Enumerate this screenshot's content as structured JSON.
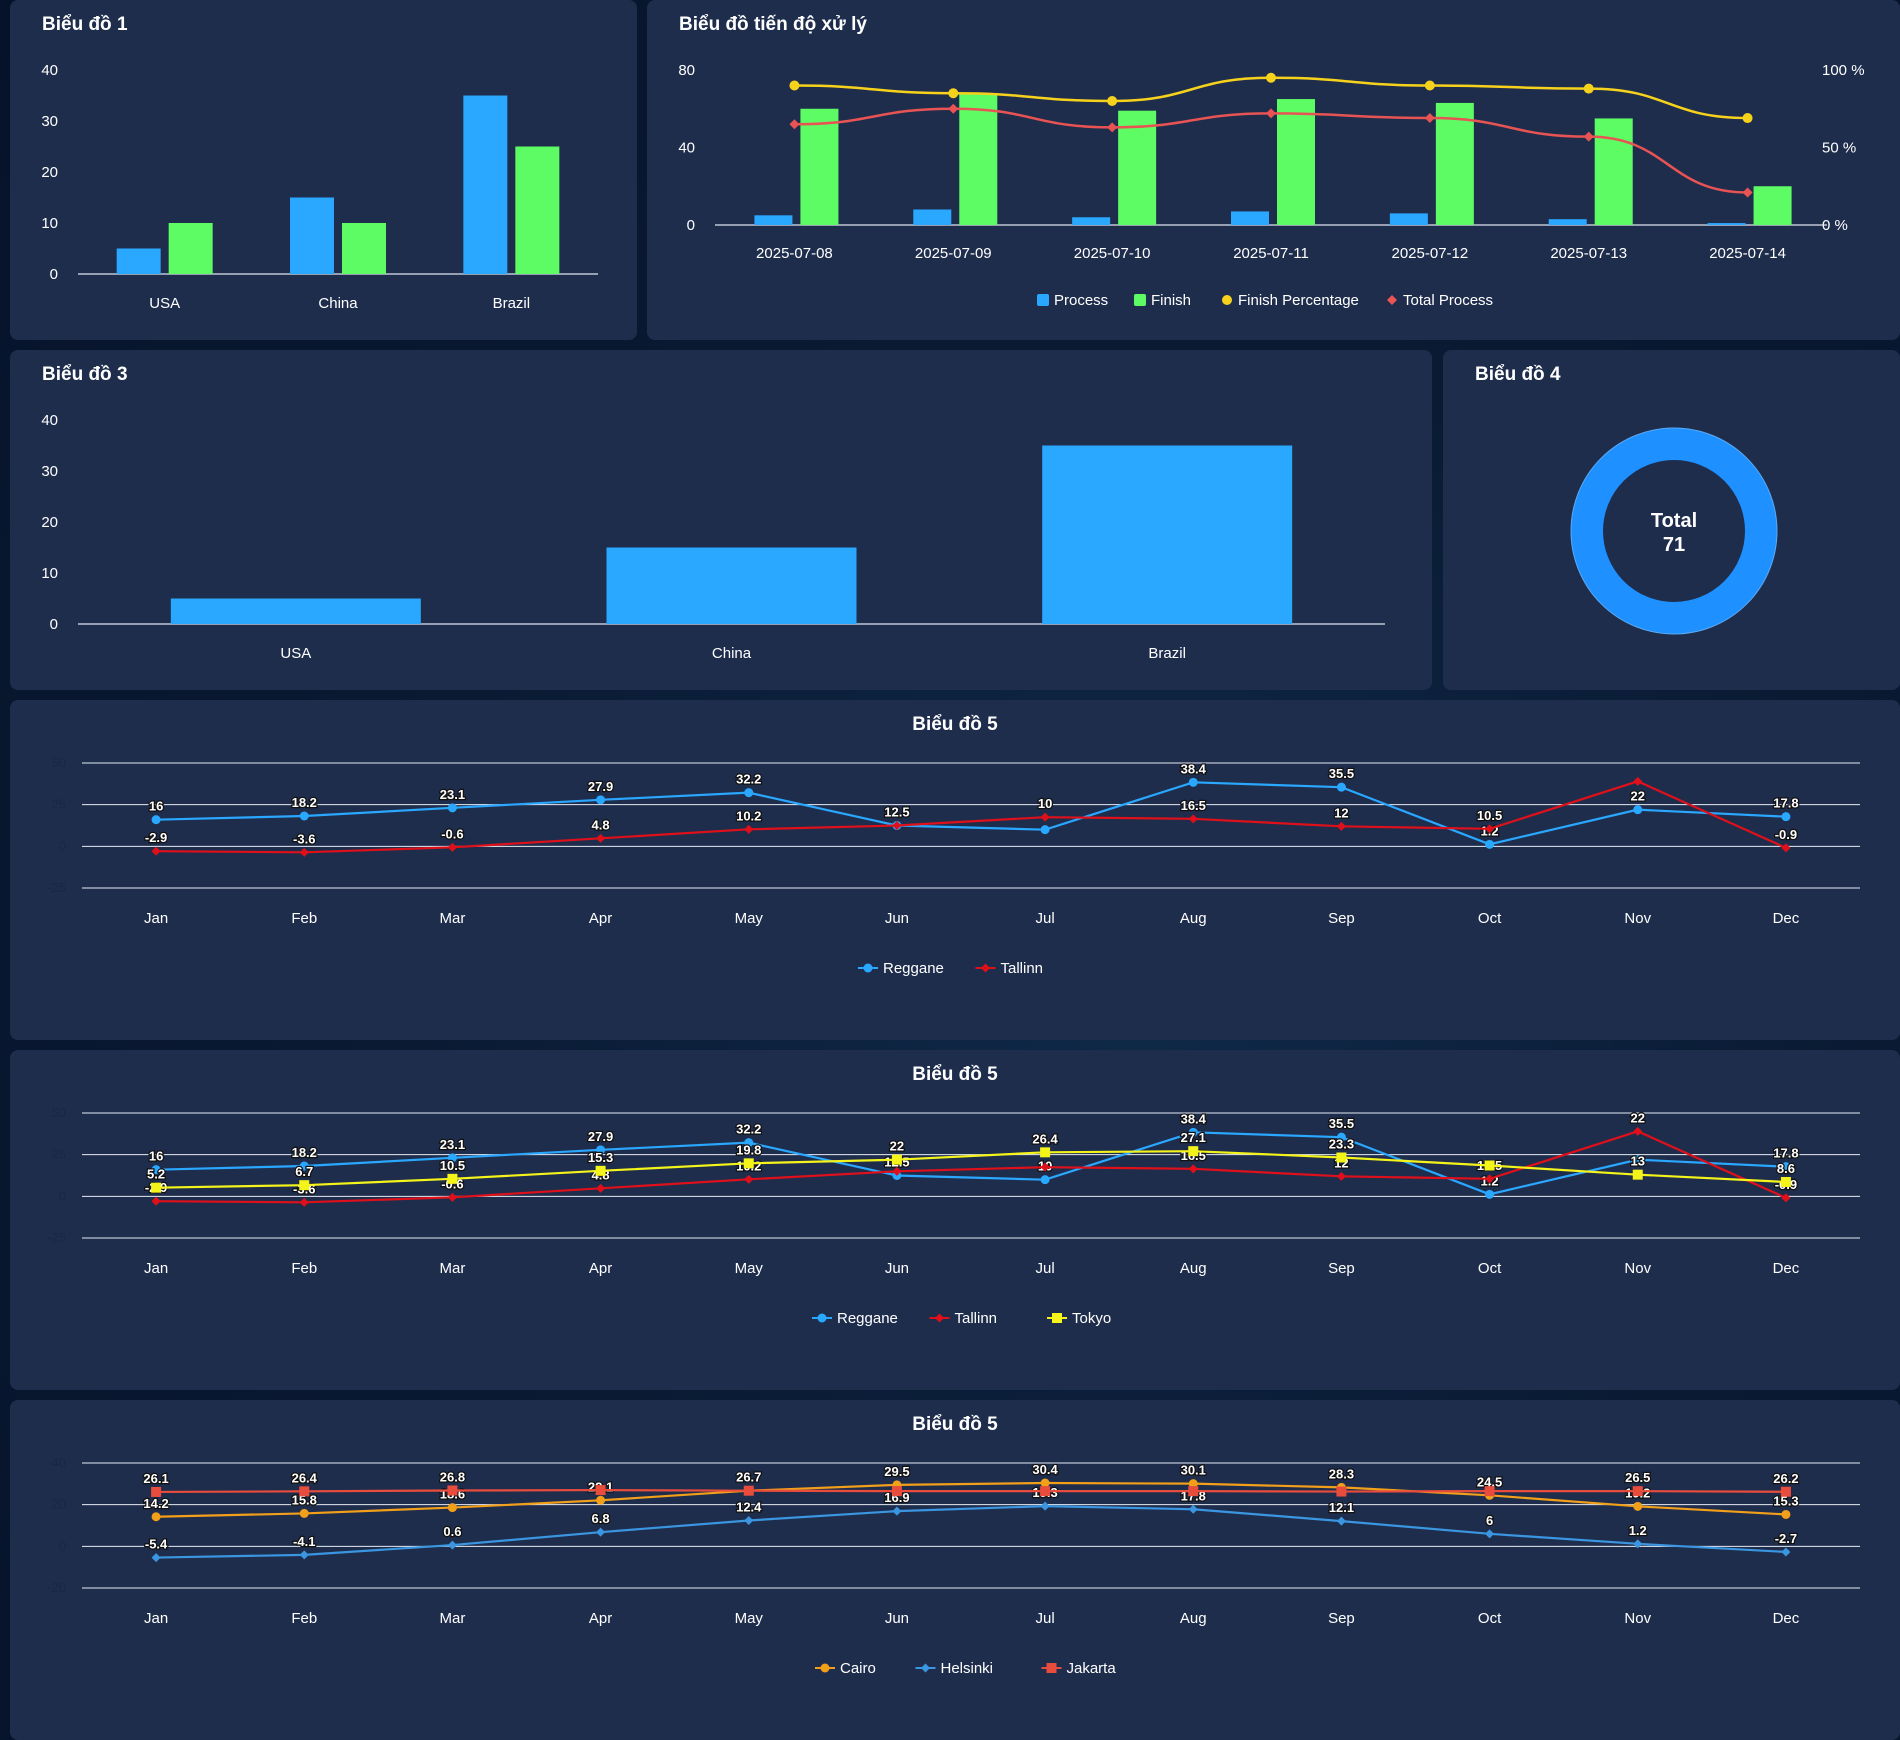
{
  "colors": {
    "panel": "#1f2d4d",
    "blue": "#2aa7ff",
    "green": "#5efc64",
    "yellow": "#f7d21c",
    "red_line": "#e85353",
    "donut": "#1e90ff",
    "reggane": "#2aa7ff",
    "tallinn": "#e0101a",
    "tokyo": "#f4f41a",
    "cairo": "#f29f1a",
    "helsinki": "#3a96e0",
    "jakarta": "#e84c3d"
  },
  "panels": {
    "p1": {
      "title": "Biểu đồ 1"
    },
    "p2": {
      "title": "Biểu đồ tiến độ xử lý"
    },
    "p3": {
      "title": "Biểu đồ 3"
    },
    "p4": {
      "title": "Biểu đồ 4",
      "center_label": "Total",
      "center_value": "71"
    },
    "p5": {
      "title": "Biểu đồ 5"
    },
    "p6": {
      "title": "Biểu đồ 5"
    },
    "p7": {
      "title": "Biểu đồ 5"
    }
  },
  "chart_data": [
    {
      "id": "chart1",
      "type": "bar",
      "categories": [
        "USA",
        "China",
        "Brazil"
      ],
      "series": [
        {
          "values": [
            5,
            15,
            35
          ]
        },
        {
          "values": [
            10,
            10,
            25
          ]
        }
      ],
      "ylim": [
        0,
        40
      ],
      "yticks": [
        0,
        10,
        20,
        30,
        40
      ],
      "grid": false
    },
    {
      "id": "chart2",
      "type": "bar",
      "categories": [
        "2025-07-08",
        "2025-07-09",
        "2025-07-10",
        "2025-07-11",
        "2025-07-12",
        "2025-07-13",
        "2025-07-14"
      ],
      "series": [
        {
          "name": "Process",
          "kind": "bar",
          "axis": "left",
          "values": [
            5,
            8,
            4,
            7,
            6,
            3,
            1
          ]
        },
        {
          "name": "Finish",
          "kind": "bar",
          "axis": "left",
          "values": [
            60,
            68,
            59,
            65,
            63,
            55,
            20
          ]
        },
        {
          "name": "Finish Percentage",
          "kind": "line",
          "axis": "right",
          "values": [
            90,
            85,
            80,
            95,
            90,
            88,
            69
          ]
        },
        {
          "name": "Total Process",
          "kind": "line",
          "axis": "right",
          "values": [
            65,
            75,
            63,
            72,
            69,
            57,
            21
          ]
        }
      ],
      "ylim_left": [
        0,
        80
      ],
      "yticks_left": [
        0,
        40,
        80
      ],
      "ylim_right": [
        0,
        100
      ],
      "yticks_right": [
        "0 %",
        "50 %",
        "100 %"
      ],
      "legend": "bottom"
    },
    {
      "id": "chart3",
      "type": "bar",
      "categories": [
        "USA",
        "China",
        "Brazil"
      ],
      "values": [
        5,
        15,
        35
      ],
      "ylim": [
        0,
        40
      ],
      "yticks": [
        0,
        10,
        20,
        30,
        40
      ]
    },
    {
      "id": "chart4",
      "type": "pie",
      "labels": [
        "Total"
      ],
      "values": [
        71
      ]
    },
    {
      "id": "chart5",
      "type": "line",
      "x": [
        "Jan",
        "Feb",
        "Mar",
        "Apr",
        "May",
        "Jun",
        "Jul",
        "Aug",
        "Sep",
        "Oct",
        "Nov",
        "Dec"
      ],
      "series": [
        {
          "name": "Reggane",
          "values": [
            16,
            18.2,
            23.1,
            27.9,
            32.2,
            12.5,
            10,
            38.4,
            35.5,
            1.2,
            22,
            17.8
          ]
        },
        {
          "name": "Tallinn",
          "values": [
            -2.9,
            -3.6,
            -0.6,
            4.8,
            10.2,
            12.5,
            17.5,
            16.5,
            12,
            10.5,
            39,
            -0.9
          ]
        }
      ],
      "data_labels": {
        "Reggane": [
          "16",
          "18.2",
          "23.1",
          "27.9",
          "32.2",
          "12.5",
          "",
          "38.4",
          "35.5",
          "1.2",
          "22",
          "17.8"
        ],
        "Tallinn": [
          "-2.9",
          "-3.6",
          "-0.6",
          "4.8",
          "10.2",
          "",
          "10",
          "16.5",
          "12",
          "10.5",
          "",
          "-0.9"
        ]
      },
      "ylim": [
        -25,
        50
      ],
      "yticks": [
        "-25",
        "0",
        "25",
        "50"
      ],
      "grid": true,
      "legend": "bottom"
    },
    {
      "id": "chart6",
      "type": "line",
      "x": [
        "Jan",
        "Feb",
        "Mar",
        "Apr",
        "May",
        "Jun",
        "Jul",
        "Aug",
        "Sep",
        "Oct",
        "Nov",
        "Dec"
      ],
      "series": [
        {
          "name": "Reggane",
          "values": [
            16,
            18.2,
            23.1,
            27.9,
            32.2,
            12.5,
            10,
            38.4,
            35.5,
            1.2,
            22,
            17.8
          ]
        },
        {
          "name": "Tallinn",
          "values": [
            -2.9,
            -3.6,
            -0.6,
            4.8,
            10.2,
            15,
            17.5,
            16.5,
            12,
            10.5,
            39,
            -0.9
          ]
        },
        {
          "name": "Tokyo",
          "values": [
            5.2,
            6.7,
            10.5,
            15.3,
            19.8,
            22,
            26.4,
            27.1,
            23.3,
            18.5,
            13,
            8.6
          ]
        }
      ],
      "data_labels": {
        "Reggane": [
          "16",
          "18.2",
          "23.1",
          "27.9",
          "32.2",
          "12.5",
          "10",
          "38.4",
          "35.5",
          "1.2",
          "",
          "17.8"
        ],
        "Tallinn": [
          "-2.9",
          "-3.6",
          "-0.6",
          "4.8",
          "10.2",
          "",
          "",
          "16.5",
          "12",
          "10.5",
          "22",
          "-0.9"
        ],
        "Tokyo": [
          "5.2",
          "6.7",
          "10.5",
          "15.3",
          "19.8",
          "22",
          "26.4",
          "27.1",
          "23.3",
          "",
          "13",
          "8.6"
        ]
      },
      "ylim": [
        -25,
        50
      ],
      "yticks": [
        "-25",
        "0",
        "25",
        "50"
      ],
      "grid": true,
      "legend": "bottom"
    },
    {
      "id": "chart7",
      "type": "line",
      "x": [
        "Jan",
        "Feb",
        "Mar",
        "Apr",
        "May",
        "Jun",
        "Jul",
        "Aug",
        "Sep",
        "Oct",
        "Nov",
        "Dec"
      ],
      "series": [
        {
          "name": "Cairo",
          "values": [
            14.2,
            15.8,
            18.6,
            22.1,
            26.7,
            29.5,
            30.4,
            30.1,
            28.3,
            24.5,
            19.2,
            15.3
          ]
        },
        {
          "name": "Helsinki",
          "values": [
            -5.4,
            -4.1,
            0.6,
            6.8,
            12.4,
            16.9,
            19.3,
            17.8,
            12.1,
            6,
            1.2,
            -2.7
          ]
        },
        {
          "name": "Jakarta",
          "values": [
            26.1,
            26.4,
            26.8,
            27,
            26.7,
            26.5,
            26.5,
            26.5,
            26.3,
            26.5,
            26.5,
            26.2
          ]
        }
      ],
      "data_labels": {
        "Cairo": [
          "14.2",
          "15.8",
          "18.6",
          "22.1",
          "",
          "29.5",
          "30.4",
          "30.1",
          "28.3",
          "24.5",
          "19.2",
          "15.3"
        ],
        "Helsinki": [
          "-5.4",
          "-4.1",
          "0.6",
          "6.8",
          "12.4",
          "16.9",
          "19.3",
          "17.8",
          "12.1",
          "6",
          "1.2",
          "-2.7"
        ],
        "Jakarta": [
          "26.1",
          "26.4",
          "26.8",
          "",
          "26.7",
          "",
          "",
          "",
          "",
          "",
          "26.5",
          "26.2"
        ]
      },
      "ylim": [
        -20,
        40
      ],
      "yticks": [
        "-20",
        "0",
        "20",
        "40"
      ],
      "grid": true,
      "legend": "bottom"
    }
  ]
}
